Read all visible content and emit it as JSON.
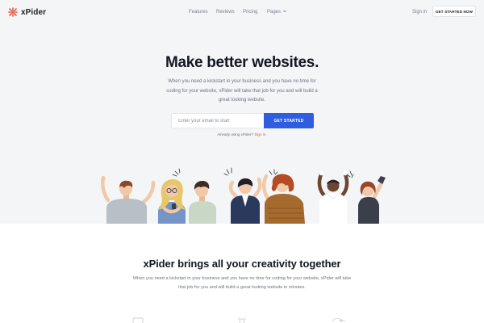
{
  "brand": {
    "name": "xPider",
    "accent": "#e8553d",
    "logo_icon": "x-logo-icon"
  },
  "nav": {
    "links": [
      {
        "label": "Features"
      },
      {
        "label": "Reviews"
      },
      {
        "label": "Pricing"
      },
      {
        "label": "Pages"
      }
    ],
    "signin_label": "Sign in",
    "cta_label": "GET STARTED NOW"
  },
  "hero": {
    "headline": "Make better websites.",
    "subtext": "When you need a kickstart in your business and you have no time for coding for your website, xPider will take that job for you and will build a great looking website.",
    "email_placeholder": "Enter your email to start",
    "email_value": "",
    "submit_label": "GET STARTED",
    "already_text": "Already using xPider?",
    "already_link": "Sign in.",
    "button_color": "#2e5de0",
    "background": "#f4f5f7"
  },
  "section2": {
    "title": "xPider brings all your creativity together",
    "text": "When you need a kickstart in your business and you have no time for coding for your website, xPider will take that job for you and will build a great looking website in minutes."
  }
}
